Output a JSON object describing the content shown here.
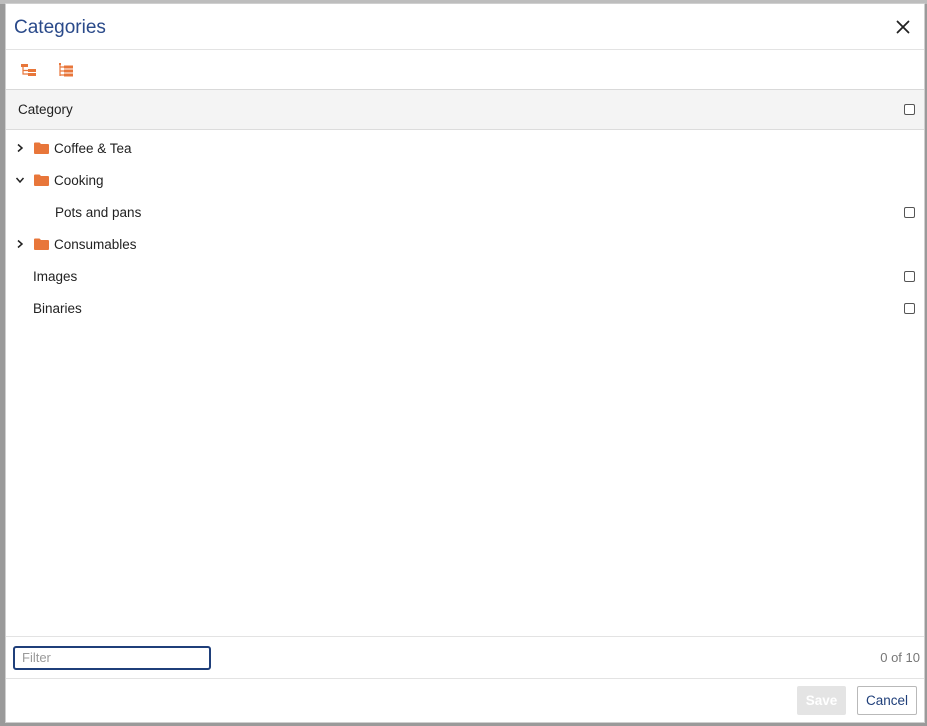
{
  "dialog": {
    "title": "Categories",
    "close_icon": "close-icon"
  },
  "toolbar": {
    "buttons": [
      {
        "icon": "tree-collapse-icon",
        "color": "#e8763a"
      },
      {
        "icon": "tree-expand-icon",
        "color": "#e8763a"
      }
    ]
  },
  "table": {
    "column_header": "Category"
  },
  "tree": {
    "items": [
      {
        "label": "Coffee & Tea",
        "expanded": false,
        "folder": true,
        "checkbox": false
      },
      {
        "label": "Cooking",
        "expanded": true,
        "folder": true,
        "checkbox": false
      },
      {
        "label": "Pots and pans",
        "folder": false,
        "checkbox": true,
        "checked": false
      },
      {
        "label": "Consumables",
        "expanded": false,
        "folder": true,
        "checkbox": false
      },
      {
        "label": "Images",
        "folder": false,
        "checkbox": true,
        "checked": false
      },
      {
        "label": "Binaries",
        "folder": false,
        "checkbox": true,
        "checked": false
      }
    ]
  },
  "footer": {
    "filter_placeholder": "Filter",
    "filter_value": "",
    "count": "0 of 10",
    "save_label": "Save",
    "cancel_label": "Cancel"
  },
  "colors": {
    "accent": "#e8763a",
    "title": "#2a4a8a",
    "focus_border": "#1f3f7a",
    "disabled_button": "#e4e4e4"
  }
}
